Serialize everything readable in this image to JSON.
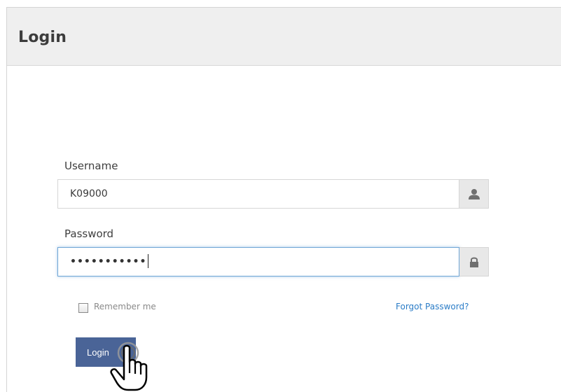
{
  "header": {
    "title": "Login"
  },
  "form": {
    "username": {
      "label": "Username",
      "value": "K09000",
      "icon": "user-icon"
    },
    "password": {
      "label": "Password",
      "masked_value": "•••••••••••",
      "icon": "lock-icon"
    },
    "remember_me": {
      "label": "Remember me",
      "checked": false
    },
    "forgot_password": "Forgot Password?",
    "submit_label": "Login"
  },
  "colors": {
    "header_bg": "#efefef",
    "button_bg": "#4a6497",
    "link": "#2a7cc7",
    "focus_border": "#6fa6d6"
  }
}
